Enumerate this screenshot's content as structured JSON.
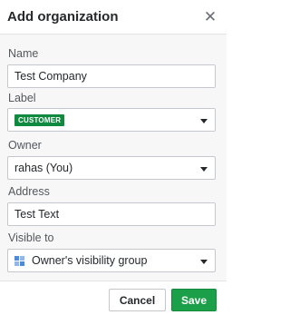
{
  "dialog": {
    "title": "Add organization",
    "close_icon": "close-icon"
  },
  "form": {
    "name": {
      "label": "Name",
      "value": "Test Company"
    },
    "label": {
      "label": "Label",
      "badge": "CUSTOMER",
      "badge_color": "#0f8a3f"
    },
    "owner": {
      "label": "Owner",
      "value": "rahas (You)"
    },
    "address": {
      "label": "Address",
      "value": "Test Text"
    },
    "visible_to": {
      "label": "Visible to",
      "value": "Owner's visibility group",
      "icon": "visibility-group-icon"
    }
  },
  "footer": {
    "cancel_label": "Cancel",
    "save_label": "Save",
    "save_color": "#1b9f48"
  }
}
